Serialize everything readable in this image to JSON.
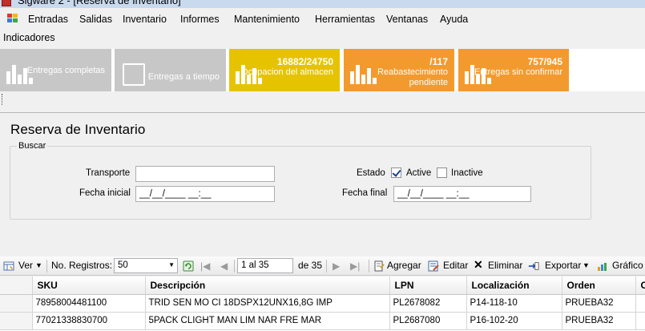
{
  "window": {
    "title": "Sigware 2 - [Reserva de Inventario]"
  },
  "menu": {
    "items": [
      "Entradas",
      "Salidas",
      "Inventario",
      "Informes",
      "Mantenimiento",
      "Herramientas",
      "Ventanas",
      "Ayuda"
    ]
  },
  "indicators": {
    "label": "Indicadores",
    "tiles": [
      {
        "value": "",
        "label": "Entregas completas",
        "icon": "bar-chart-icon",
        "color": "#c7c7c7"
      },
      {
        "value": "",
        "label": "Entregas a tiempo",
        "icon": "clipboard-icon",
        "color": "#c7c7c7"
      },
      {
        "value": "16882/24750",
        "label": "Ocupacion del almacen",
        "icon": "bar-chart-icon",
        "color": "#e6c300"
      },
      {
        "value": "/117",
        "label": "Reabastecimiento pendiente",
        "icon": "bar-chart-icon",
        "color": "#f39a2e"
      },
      {
        "value": "757/945",
        "label": "Entregas sin confirmar",
        "icon": "bar-chart-icon",
        "color": "#f39a2e"
      }
    ]
  },
  "form": {
    "title": "Reserva de Inventario",
    "group_label": "Buscar",
    "transporte_label": "Transporte",
    "transporte_value": "",
    "fecha_inicial_label": "Fecha inicial",
    "fecha_inicial_value": "__/__/____  __:__",
    "estado_label": "Estado",
    "active_label": "Active",
    "active_checked": true,
    "inactive_label": "Inactive",
    "inactive_checked": false,
    "fecha_final_label": "Fecha final",
    "fecha_final_value": "__/__/____  __:__"
  },
  "toolbar": {
    "ver_label": "Ver",
    "registros_label": "No. Registros:",
    "registros_value": "50",
    "page_value": "1 al 35",
    "page_total": "de 35",
    "agregar_label": "Agregar",
    "editar_label": "Editar",
    "eliminar_label": "Eliminar",
    "exportar_label": "Exportar",
    "grafico_label": "Gráfico"
  },
  "table": {
    "columns": [
      "SKU",
      "Descripción",
      "LPN",
      "Localización",
      "Orden",
      "C"
    ],
    "rows": [
      [
        "78958004481100",
        "TRID SEN MO CI 18DSPX12UNX16,8G IMP",
        "PL2678082",
        "P14-118-10",
        "PRUEBA32",
        ""
      ],
      [
        "77021338830700",
        "5PACK CLIGHT MAN LIM NAR FRE MAR",
        "PL2687080",
        "P16-102-20",
        "PRUEBA32",
        ""
      ]
    ]
  }
}
